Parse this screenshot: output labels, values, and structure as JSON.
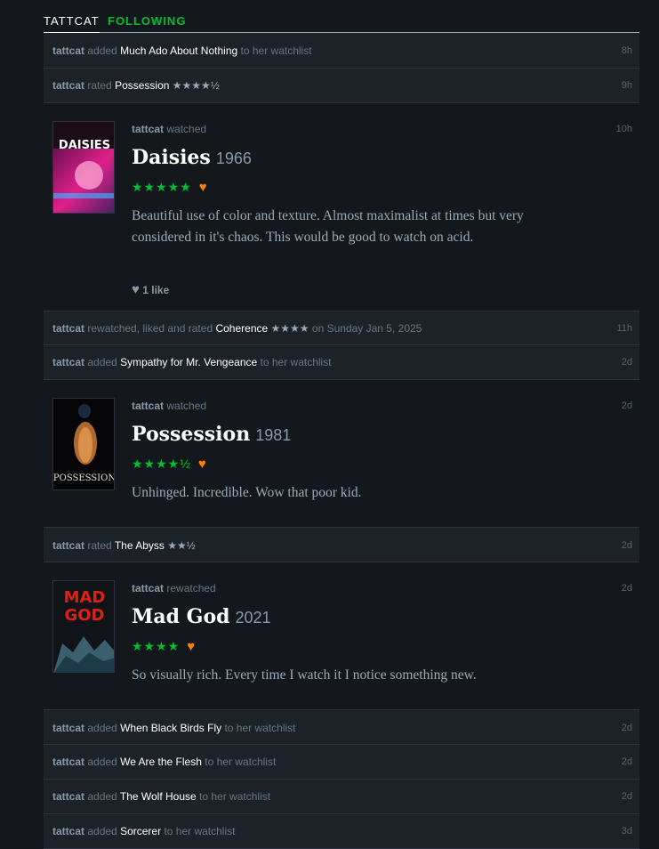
{
  "tabs": [
    "TATTCAT",
    "FOLLOWING"
  ],
  "feed": {
    "row1": {
      "user": "tattcat",
      "action": "added",
      "film": "Much Ado About Nothing",
      "suffix": "to her watchlist",
      "time": "8h"
    },
    "row2": {
      "user": "tattcat",
      "action": "rated",
      "film": "Possession",
      "stars": "★★★★½",
      "time": "9h"
    },
    "review1": {
      "user": "tattcat",
      "action": "watched",
      "time": "10h",
      "title": "Daisies",
      "year": "1966",
      "stars": "★★★★★",
      "heart": "♥",
      "text": "Beautiful use of color and texture. Almost maximalist at times but very considered in it's chaos. This would be good to watch on acid.",
      "likes": "1 like",
      "poster_text": "DAISIES"
    },
    "row3": {
      "user": "tattcat",
      "action": "rewatched, liked and rated",
      "film": "Coherence",
      "stars": "★★★★",
      "suffix": "on Sunday Jan 5, 2025",
      "time": "11h"
    },
    "row4": {
      "user": "tattcat",
      "action": "added",
      "film": "Sympathy for Mr. Vengeance",
      "suffix": "to her watchlist",
      "time": "2d"
    },
    "review2": {
      "user": "tattcat",
      "action": "watched",
      "time": "2d",
      "title": "Possession",
      "year": "1981",
      "stars": "★★★★½",
      "heart": "♥",
      "text": "Unhinged. Incredible. Wow that poor kid.",
      "poster_text": "POSSESSION"
    },
    "row5": {
      "user": "tattcat",
      "action": "rated",
      "film": "The Abyss",
      "stars": "★★½",
      "time": "2d"
    },
    "review3": {
      "user": "tattcat",
      "action": "rewatched",
      "time": "2d",
      "title": "Mad God",
      "year": "2021",
      "stars": "★★★★",
      "heart": "♥",
      "text": "So visually rich. Every time I watch it I notice something new.",
      "poster_text": "MAD GOD"
    },
    "row6": {
      "user": "tattcat",
      "action": "added",
      "film": "When Black Birds Fly",
      "suffix": "to her watchlist",
      "time": "2d"
    },
    "row7": {
      "user": "tattcat",
      "action": "added",
      "film": "We Are the Flesh",
      "suffix": "to her watchlist",
      "time": "2d"
    },
    "row8": {
      "user": "tattcat",
      "action": "added",
      "film": "The Wolf House",
      "suffix": "to her watchlist",
      "time": "2d"
    },
    "row9": {
      "user": "tattcat",
      "action": "added",
      "film": "Sorcerer",
      "suffix": "to her watchlist",
      "time": "3d"
    }
  },
  "colors": {
    "accent": "#00c030",
    "heart": "#ff8000",
    "bg": "#14181c",
    "row": "#1c2228"
  }
}
